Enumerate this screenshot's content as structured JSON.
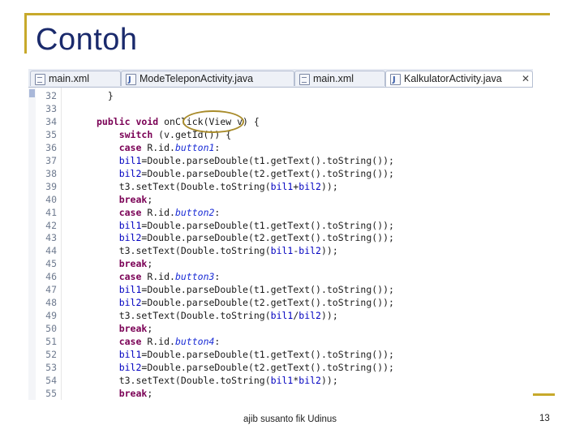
{
  "slide": {
    "title": "Contoh",
    "footer": "ajib susanto fik Udinus",
    "page_number": "13"
  },
  "tabs": [
    {
      "label": "main.xml",
      "icon": "xml-file-icon"
    },
    {
      "label": "ModeTeleponActivity.java",
      "icon": "java-file-icon"
    },
    {
      "label": "main.xml",
      "icon": "xml-file-icon"
    },
    {
      "label": "KalkulatorActivity.java",
      "icon": "java-file-icon",
      "active": true,
      "close": "✕"
    }
  ],
  "line_numbers": [
    "32",
    "33",
    "34",
    "35",
    "36",
    "37",
    "38",
    "39",
    "40",
    "41",
    "42",
    "43",
    "44",
    "45",
    "46",
    "47",
    "48",
    "49",
    "50",
    "51",
    "52",
    "53",
    "54",
    "55"
  ],
  "code": [
    "  }",
    "",
    "public void onClick(View v) {",
    "    switch (v.getId()) {",
    "    case R.id.button1:",
    "    bil1=Double.parseDouble(t1.getText().toString());",
    "    bil2=Double.parseDouble(t2.getText().toString());",
    "    t3.setText(Double.toString(bil1+bil2));",
    "    break;",
    "    case R.id.button2:",
    "    bil1=Double.parseDouble(t1.getText().toString());",
    "    bil2=Double.parseDouble(t2.getText().toString());",
    "    t3.setText(Double.toString(bil1-bil2));",
    "    break;",
    "    case R.id.button3:",
    "    bil1=Double.parseDouble(t1.getText().toString());",
    "    bil2=Double.parseDouble(t2.getText().toString());",
    "    t3.setText(Double.toString(bil1/bil2));",
    "    break;",
    "    case R.id.button4:",
    "    bil1=Double.parseDouble(t1.getText().toString());",
    "    bil2=Double.parseDouble(t2.getText().toString());",
    "    t3.setText(Double.toString(bil1*bil2));",
    "    break;"
  ],
  "colors": {
    "accent": "#c7a92b",
    "title": "#1a2a6c",
    "keyword": "#7a0055",
    "field": "#0000c0"
  }
}
